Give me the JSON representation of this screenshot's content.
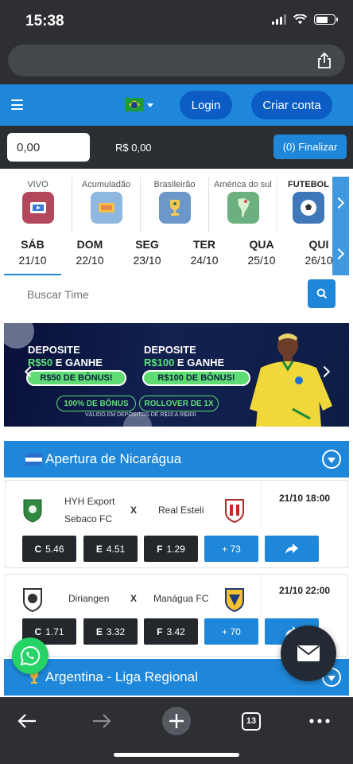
{
  "status_bar": {
    "time": "15:38"
  },
  "browser": {
    "url": "",
    "tab_count": "13"
  },
  "header": {
    "login": "Login",
    "register": "Criar conta"
  },
  "bet_bar": {
    "stake_value": "0,00",
    "total": "R$ 0,00",
    "finish": "(0) Finalizar"
  },
  "categories": [
    {
      "label": "VIVO",
      "icon": "tv-icon",
      "color": "#b3475b"
    },
    {
      "label": "Acumuladão",
      "icon": "ticket-icon",
      "color": "#e8a64a"
    },
    {
      "label": "Brasileirão",
      "icon": "trophy-icon",
      "color": "#4a6fb3"
    },
    {
      "label": "América do sul",
      "icon": "south-america-icon",
      "color": "#5aa66e"
    },
    {
      "label": "FUTEBOL",
      "icon": "soccer-ball-icon",
      "color": "#3a6ea8"
    }
  ],
  "dates": [
    {
      "day": "SÁB",
      "date": "21/10"
    },
    {
      "day": "DOM",
      "date": "22/10"
    },
    {
      "day": "SEG",
      "date": "23/10"
    },
    {
      "day": "TER",
      "date": "24/10"
    },
    {
      "day": "QUA",
      "date": "25/10"
    },
    {
      "day": "QUI",
      "date": "26/10"
    }
  ],
  "search": {
    "placeholder": "Buscar Time"
  },
  "banner": {
    "left_line1": "DEPOSITE",
    "left_line2a": "R$50",
    "left_line2b": " E GANHE",
    "left_pill": "R$50 DE BÔNUS!",
    "right_line1": "DEPOSITE",
    "right_line2a": "R$100",
    "right_line2b": " E GANHE",
    "right_pill": "R$100 DE BÔNUS!",
    "badge1": "100% DE BÔNUS",
    "badge2": "ROLLOVER DE 1X",
    "footnote": "VÁLIDO EM DEPÓSITOS DE R$10 A R$300"
  },
  "leagues": [
    {
      "name": "Apertura de Nicarágua",
      "matches": [
        {
          "home": "HYH Export Sebaco FC",
          "home_line1": "HYH Export",
          "home_line2": "Sebaco FC",
          "away": "Real Esteli",
          "vs": "X",
          "datetime": "21/10 18:00",
          "odds": [
            {
              "label": "C",
              "value": "5.46"
            },
            {
              "label": "E",
              "value": "4.51"
            },
            {
              "label": "F",
              "value": "1.29"
            }
          ],
          "more": "+ 73"
        },
        {
          "home": "Diriangen",
          "away": "Manágua FC",
          "vs": "X",
          "datetime": "21/10 22:00",
          "odds": [
            {
              "label": "C",
              "value": "1.71"
            },
            {
              "label": "E",
              "value": "3.32"
            },
            {
              "label": "F",
              "value": "3.42"
            }
          ],
          "more": "+ 70"
        }
      ]
    },
    {
      "name": "Argentina - Liga Regional"
    }
  ],
  "colors": {
    "primary": "#1f87d9",
    "dark": "#2d2f33",
    "odd_button": "#24282d",
    "whatsapp": "#25d366"
  }
}
